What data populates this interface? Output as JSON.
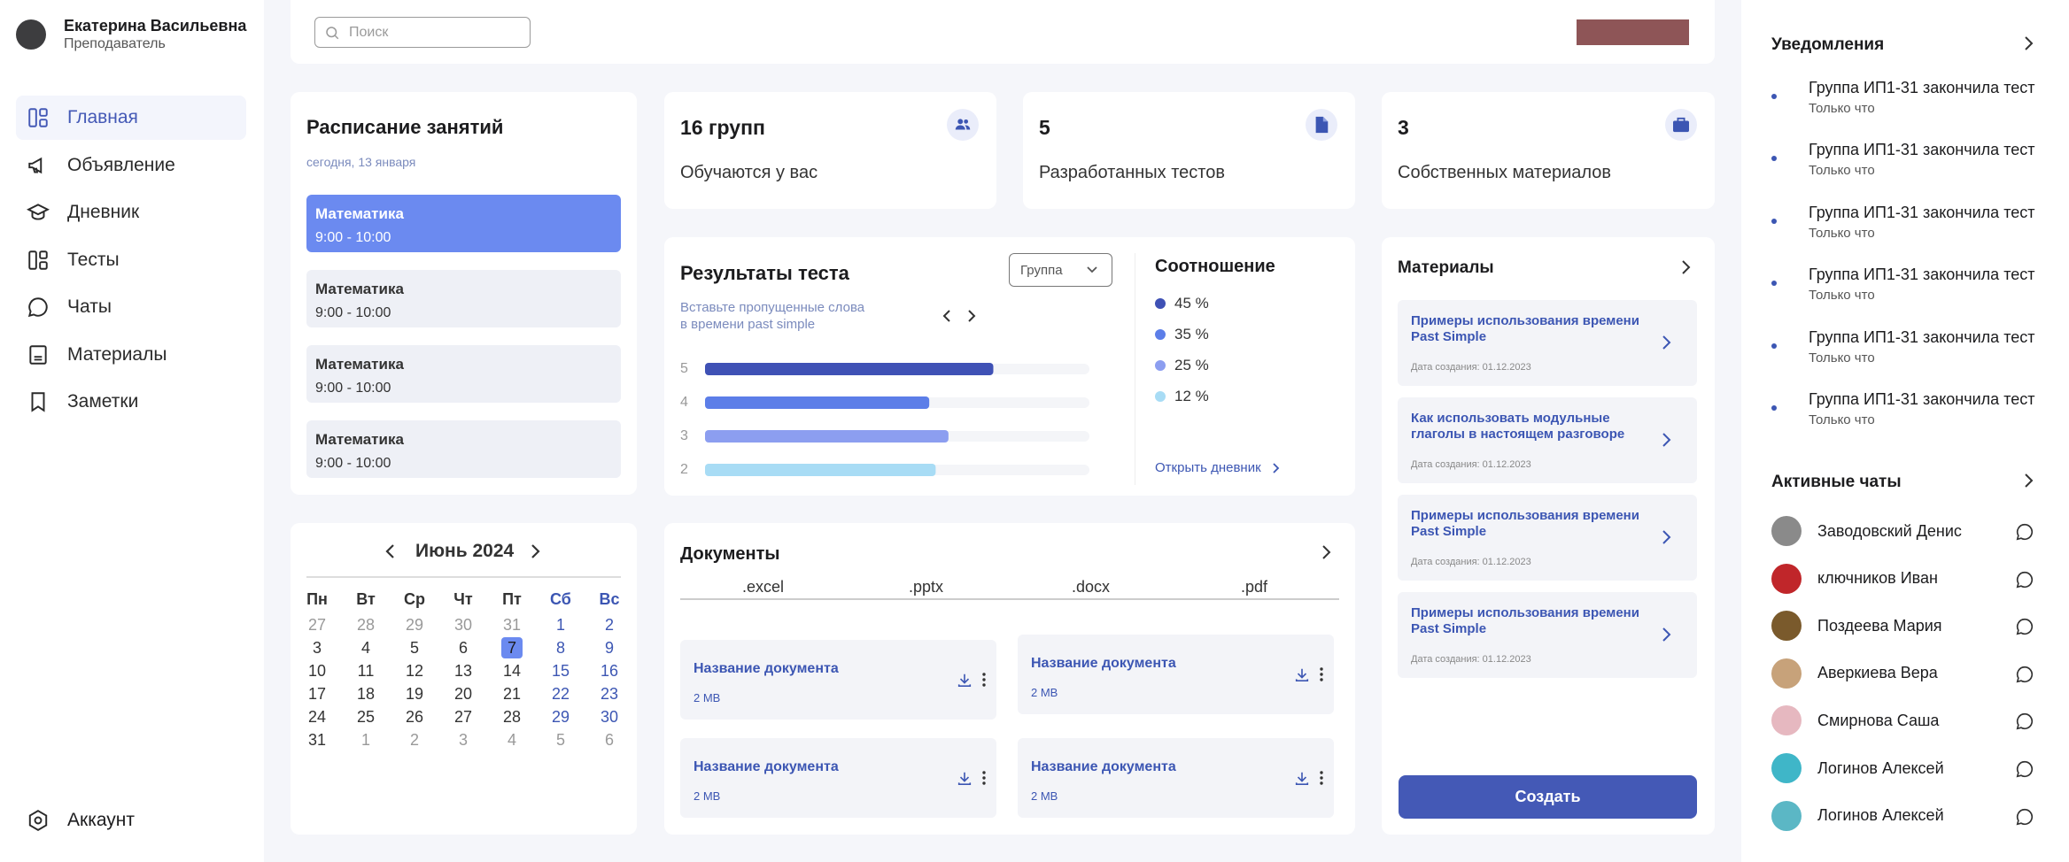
{
  "user": {
    "name": "Екатерина Васильевна",
    "role": "Преподаватель"
  },
  "nav": [
    {
      "label": "Главная",
      "icon": "dashboard-icon",
      "active": true
    },
    {
      "label": "Объявление",
      "icon": "megaphone-icon"
    },
    {
      "label": "Дневник",
      "icon": "graduation-cap-icon"
    },
    {
      "label": "Тесты",
      "icon": "tests-icon"
    },
    {
      "label": "Чаты",
      "icon": "chat-icon"
    },
    {
      "label": "Материалы",
      "icon": "document-icon"
    },
    {
      "label": "Заметки",
      "icon": "bookmark-icon"
    }
  ],
  "account_label": "Аккаунт",
  "search": {
    "placeholder": "Поиск"
  },
  "schedule": {
    "title": "Расписание занятий",
    "date": "сегодня, 13 января",
    "lessons": [
      {
        "subject": "Математика",
        "time": "9:00 - 10:00",
        "active": true
      },
      {
        "subject": "Математика",
        "time": "9:00 - 10:00"
      },
      {
        "subject": "Математика",
        "time": "9:00 - 10:00"
      },
      {
        "subject": "Математика",
        "time": "9:00 - 10:00"
      }
    ]
  },
  "calendar": {
    "month": "Июнь 2024",
    "weekdays": [
      "Пн",
      "Вт",
      "Ср",
      "Чт",
      "Пт",
      "Сб",
      "Вс"
    ],
    "weeks": [
      [
        "27",
        "28",
        "29",
        "30",
        "31",
        "1",
        "2"
      ],
      [
        "3",
        "4",
        "5",
        "6",
        "7",
        "8",
        "9"
      ],
      [
        "10",
        "11",
        "12",
        "13",
        "14",
        "15",
        "16"
      ],
      [
        "17",
        "18",
        "19",
        "20",
        "21",
        "22",
        "23"
      ],
      [
        "24",
        "25",
        "26",
        "27",
        "28",
        "29",
        "30"
      ],
      [
        "31",
        "1",
        "2",
        "3",
        "4",
        "5",
        "6"
      ]
    ],
    "selected": "7"
  },
  "stats": [
    {
      "value": "16 групп",
      "label": "Обучаются у вас",
      "icon": "users-icon"
    },
    {
      "value": "5",
      "label": "Разработанных тестов",
      "icon": "file-icon"
    },
    {
      "value": "3",
      "label": "Собственных материалов",
      "icon": "briefcase-icon"
    }
  ],
  "test_results": {
    "title": "Результаты теста",
    "subtitle_line1": "Вставьте пропущенные слова",
    "subtitle_line2": "в времени past simple",
    "group_select": "Группа"
  },
  "ratio": {
    "title": "Соотношение",
    "items": [
      {
        "label": "45 %",
        "color": "#3f51b5"
      },
      {
        "label": "35 %",
        "color": "#5c7ee8"
      },
      {
        "label": "25 %",
        "color": "#8c9ef0"
      },
      {
        "label": "12 %",
        "color": "#a8dcf5"
      }
    ],
    "open_link": "Открыть дневник"
  },
  "chart_data": {
    "type": "bar",
    "orientation": "horizontal",
    "categories": [
      "5",
      "4",
      "3",
      "2"
    ],
    "values": [
      45,
      35,
      38,
      36
    ],
    "colors": [
      "#3f51b5",
      "#5c7ee8",
      "#8c9ef0",
      "#a8dcf5"
    ],
    "xlim": [
      0,
      60
    ]
  },
  "documents": {
    "title": "Документы",
    "tabs": [
      ".excel",
      ".pptx",
      ".docx",
      ".pdf"
    ],
    "items": [
      {
        "name": "Название документа",
        "size": "2 MB"
      },
      {
        "name": "Название документа",
        "size": "2 MB"
      },
      {
        "name": "Название документа",
        "size": "2 MB"
      },
      {
        "name": "Название документа",
        "size": "2 MB"
      }
    ]
  },
  "materials": {
    "title": "Материалы",
    "items": [
      {
        "title": "Примеры использования времени Past Simple",
        "date": "Дата создания:  01.12.2023"
      },
      {
        "title": "Как использовать модульные глаголы в настоящем разговоре",
        "date": "Дата создания:  01.12.2023"
      },
      {
        "title": "Примеры использования времени Past Simple",
        "date": "Дата создания:  01.12.2023"
      },
      {
        "title": "Примеры использования времени Past Simple",
        "date": "Дата создания:  01.12.2023"
      }
    ],
    "create_button": "Создать"
  },
  "notifications": {
    "title": "Уведомления",
    "items": [
      {
        "text": "Группа ИП1-31 закончила тест",
        "time": "Только что"
      },
      {
        "text": "Группа ИП1-31 закончила тест",
        "time": "Только что"
      },
      {
        "text": "Группа ИП1-31 закончила тест",
        "time": "Только что"
      },
      {
        "text": "Группа ИП1-31 закончила тест",
        "time": "Только что"
      },
      {
        "text": "Группа ИП1-31 закончила тест",
        "time": "Только что"
      },
      {
        "text": "Группа ИП1-31 закончила тест",
        "time": "Только что"
      }
    ]
  },
  "chats": {
    "title": "Активные чаты",
    "items": [
      {
        "name": "Заводовский Денис",
        "color": "#8a8a8a"
      },
      {
        "name": "ключников Иван",
        "color": "#c0262a"
      },
      {
        "name": "Поздеева Мария",
        "color": "#7a5a2c"
      },
      {
        "name": "Аверкиева Вера",
        "color": "#c7a27a"
      },
      {
        "name": "Смирнова Саша",
        "color": "#e6b8c0"
      },
      {
        "name": "Логинов Алексей",
        "color": "#3fb6c8"
      },
      {
        "name": "Логинов Алексей",
        "color": "#5bb7c5"
      }
    ]
  },
  "colors": {
    "accent": "#3c56b3",
    "active_lesson": "#6b8af0",
    "top_button": "#8e5557"
  }
}
